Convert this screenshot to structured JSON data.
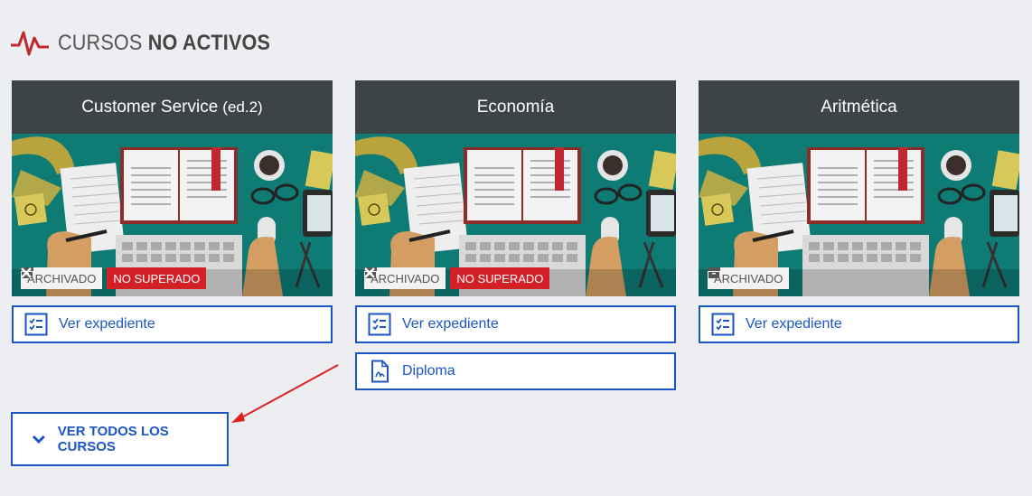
{
  "section": {
    "title_regular": "CURSOS",
    "title_bold": "NO ACTIVOS"
  },
  "courses": [
    {
      "title": "Customer Service",
      "suffix": "(ed.2)",
      "badges": {
        "archived": "ARCHIVADO",
        "failed": "NO SUPERADO"
      },
      "button_record": "Ver expediente"
    },
    {
      "title": "Economía",
      "badges": {
        "archived": "ARCHIVADO",
        "failed": "NO SUPERADO"
      },
      "button_record": "Ver expediente",
      "button_diploma": "Diploma"
    },
    {
      "title": "Aritmética",
      "badges": {
        "archived": "ARCHIVADO"
      },
      "button_record": "Ver expediente"
    }
  ],
  "all_courses_button": "VER TODOS LOS CURSOS",
  "colors": {
    "accent": "#1c56c4",
    "danger": "#d32027",
    "header": "#3d4447",
    "teal": "#0e7b74"
  }
}
